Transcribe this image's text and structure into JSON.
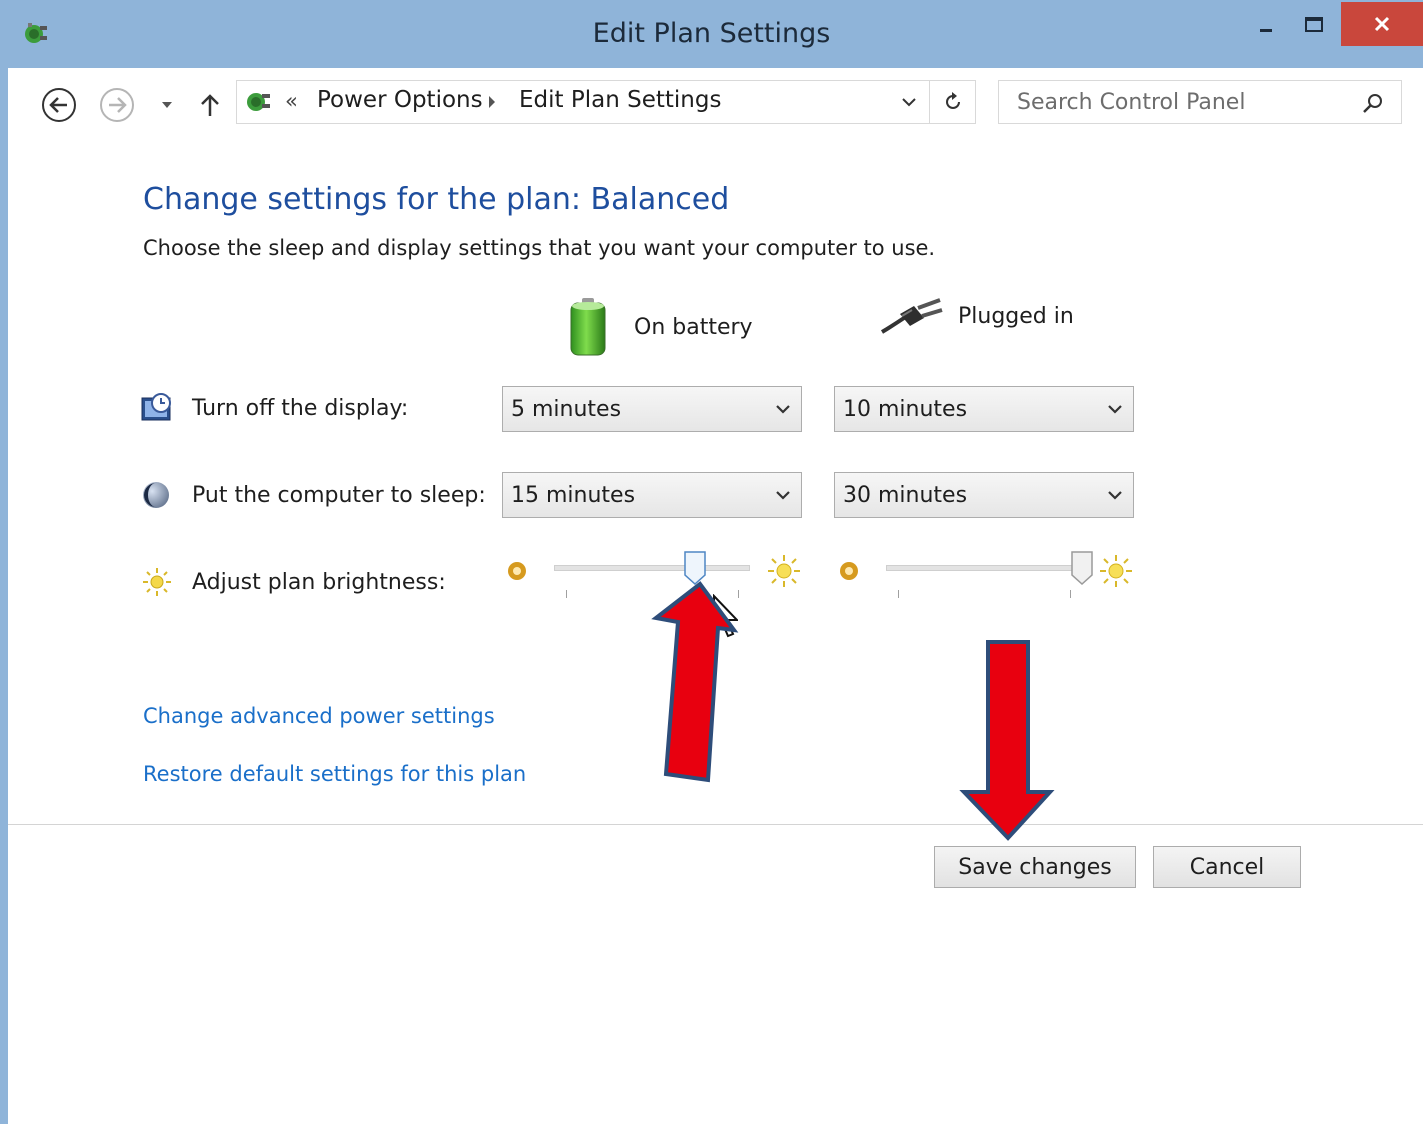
{
  "window": {
    "title": "Edit Plan Settings"
  },
  "nav": {
    "breadcrumb_chevron": "«",
    "crumbs": [
      "Power Options",
      "Edit Plan Settings"
    ],
    "search_placeholder": "Search Control Panel"
  },
  "main": {
    "heading": "Change settings for the plan: Balanced",
    "subheading": "Choose the sleep and display settings that you want your computer to use.",
    "columns": {
      "battery": "On battery",
      "plugged": "Plugged in"
    },
    "rows": {
      "display": {
        "label": "Turn off the display:",
        "battery_value": "5 minutes",
        "plugged_value": "10 minutes"
      },
      "sleep": {
        "label": "Put the computer to sleep:",
        "battery_value": "15 minutes",
        "plugged_value": "30 minutes"
      },
      "brightness": {
        "label": "Adjust plan brightness:",
        "battery_level": 0.72,
        "plugged_level": 1.0
      }
    },
    "links": {
      "advanced": "Change advanced power settings",
      "restore": "Restore default settings for this plan"
    }
  },
  "footer": {
    "save_label": "Save changes",
    "cancel_label": "Cancel"
  },
  "colors": {
    "titlebar": "#8fb4d9",
    "close_button": "#c9473c",
    "heading": "#1e4e9e",
    "link": "#1a6fc9",
    "annotation_arrow": "#e8000f"
  }
}
